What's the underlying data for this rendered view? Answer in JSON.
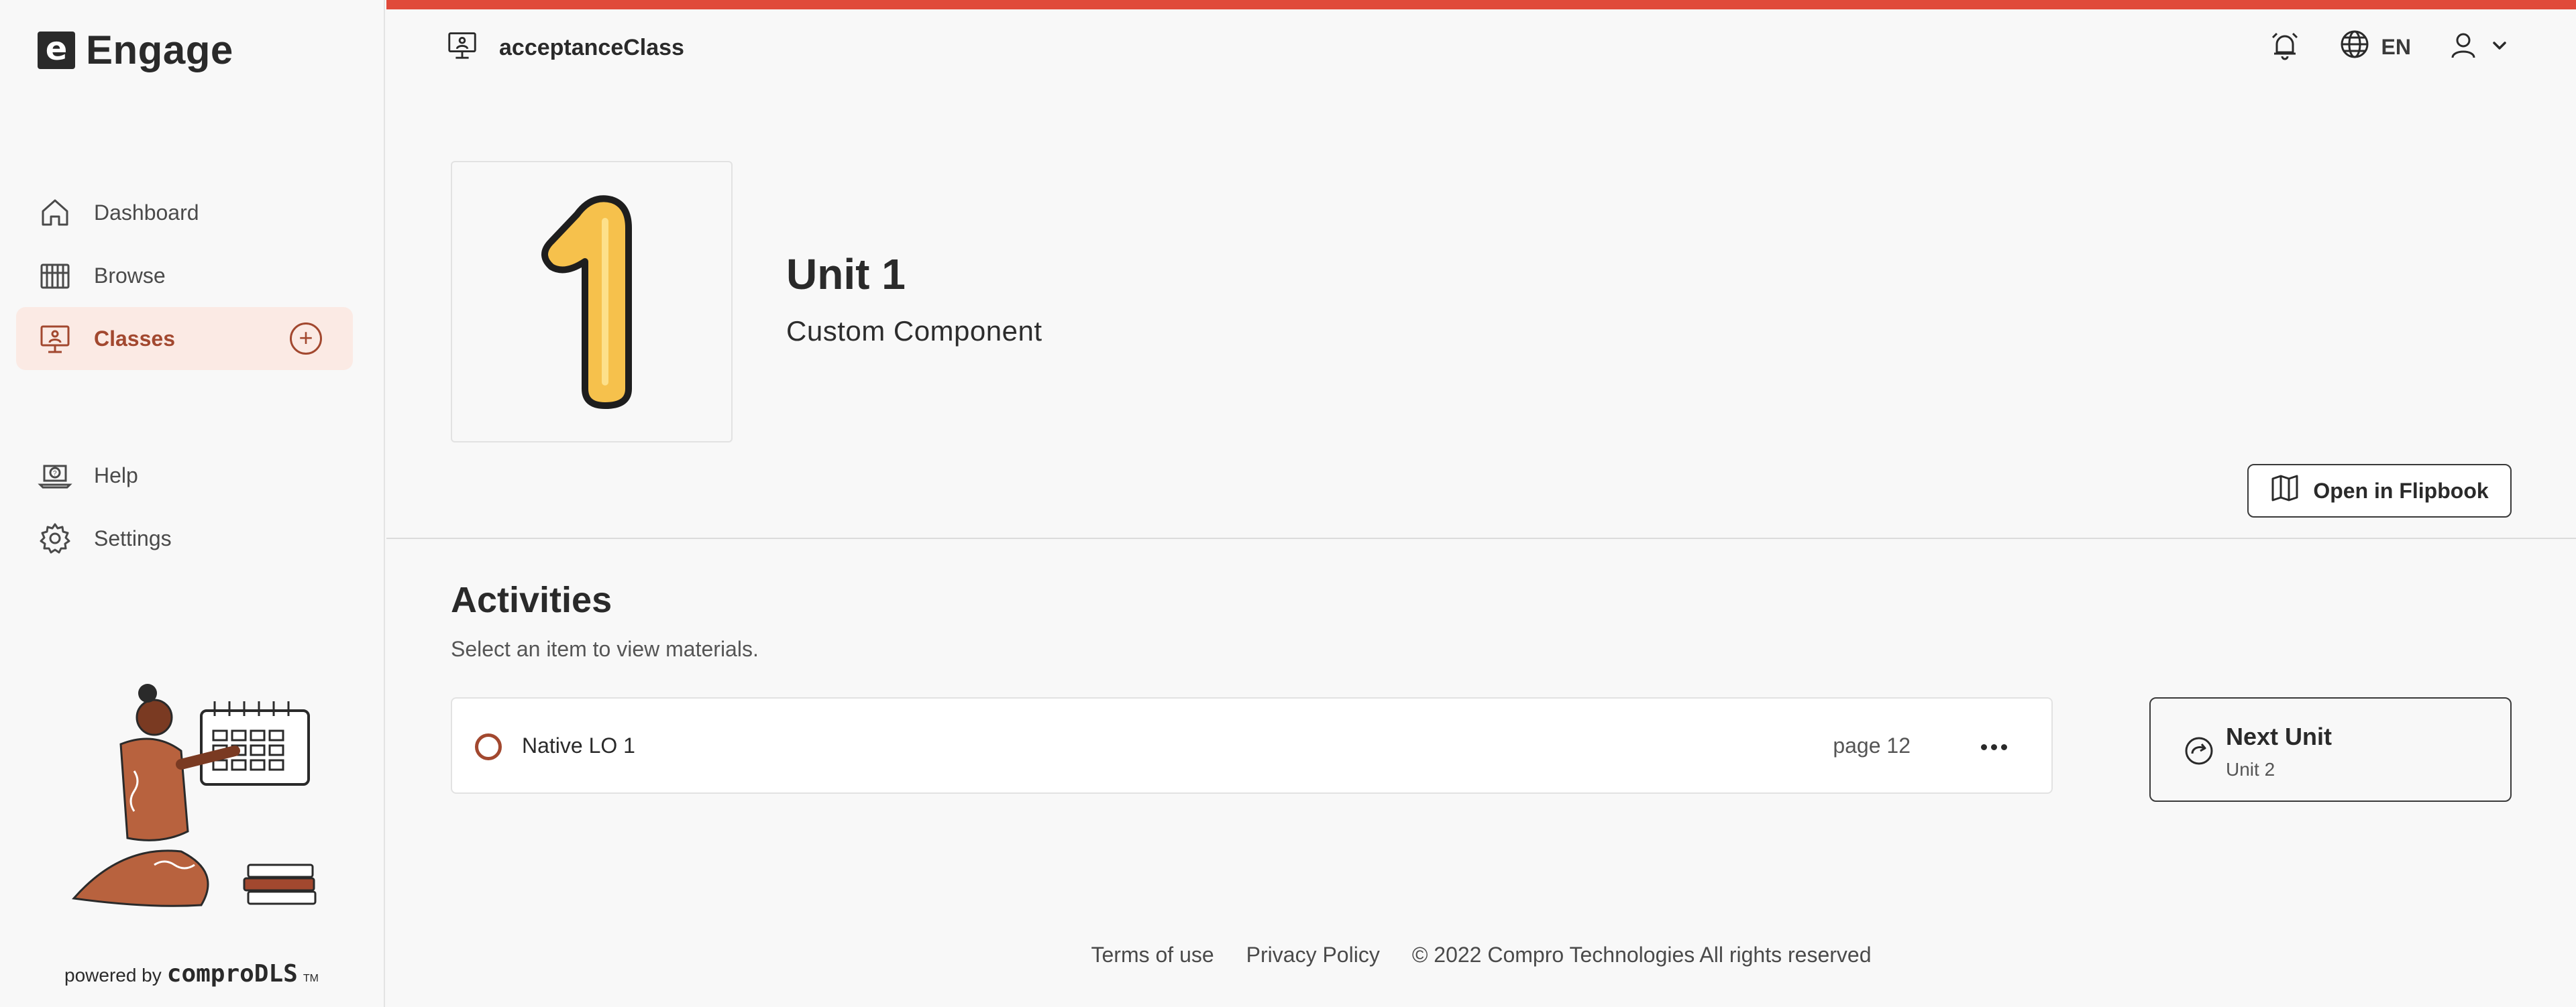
{
  "app": {
    "name": "Engage",
    "logo_letter": "e"
  },
  "sidebar": {
    "items": [
      {
        "label": "Dashboard",
        "icon": "home-icon"
      },
      {
        "label": "Browse",
        "icon": "books-icon"
      },
      {
        "label": "Classes",
        "icon": "presentation-icon",
        "active": true,
        "add_icon": "plus-circle-icon"
      },
      {
        "label": "Help",
        "icon": "help-laptop-icon"
      },
      {
        "label": "Settings",
        "icon": "gear-icon"
      }
    ],
    "powered_by_prefix": "powered by",
    "powered_by_brand": "comproDLS",
    "powered_by_tm": "TM"
  },
  "header": {
    "class_name": "acceptanceClass",
    "class_icon": "presentation-icon",
    "language": "EN",
    "icons": [
      "alarm-icon",
      "globe-icon",
      "user-icon",
      "chevron-down-icon"
    ]
  },
  "unit": {
    "number": "1",
    "title": "Unit 1",
    "subtitle": "Custom Component",
    "flipbook_button": "Open in Flipbook"
  },
  "activities": {
    "title": "Activities",
    "subtitle": "Select an item to view materials.",
    "items": [
      {
        "name": "Native LO 1",
        "page": "page 12"
      }
    ]
  },
  "next_unit": {
    "label": "Next Unit",
    "unit": "Unit 2"
  },
  "footer": {
    "terms": "Terms of use",
    "privacy": "Privacy Policy",
    "copyright": "© 2022 Compro Technologies All rights reserved"
  },
  "colors": {
    "accent_bar": "#e04a3a",
    "brand_rust": "#a2482f",
    "active_bg": "#fbeae4",
    "number_yellow": "#f6c14c"
  }
}
